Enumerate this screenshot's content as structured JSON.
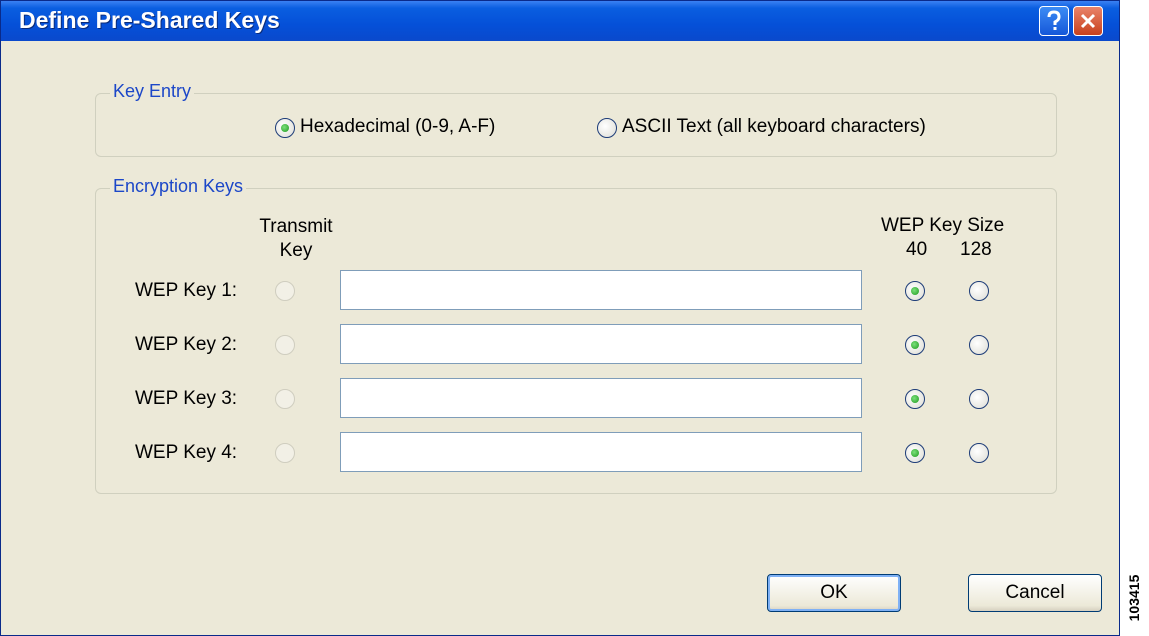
{
  "window": {
    "title": "Define Pre-Shared Keys"
  },
  "key_entry": {
    "legend": "Key Entry",
    "options": [
      {
        "label": "Hexadecimal (0-9, A-F)",
        "selected": true
      },
      {
        "label": "ASCII Text (all keyboard characters)",
        "selected": false
      }
    ]
  },
  "encryption_keys": {
    "legend": "Encryption Keys",
    "transmit_header_line1": "Transmit",
    "transmit_header_line2": "Key",
    "size_header": "WEP Key Size",
    "size_40": "40",
    "size_128": "128",
    "keys": [
      {
        "label": "WEP Key 1:",
        "value": "",
        "size": "40"
      },
      {
        "label": "WEP Key 2:",
        "value": "",
        "size": "40"
      },
      {
        "label": "WEP Key 3:",
        "value": "",
        "size": "40"
      },
      {
        "label": "WEP Key 4:",
        "value": "",
        "size": "40"
      }
    ]
  },
  "buttons": {
    "ok": "OK",
    "cancel": "Cancel"
  },
  "figure_id": "103415"
}
